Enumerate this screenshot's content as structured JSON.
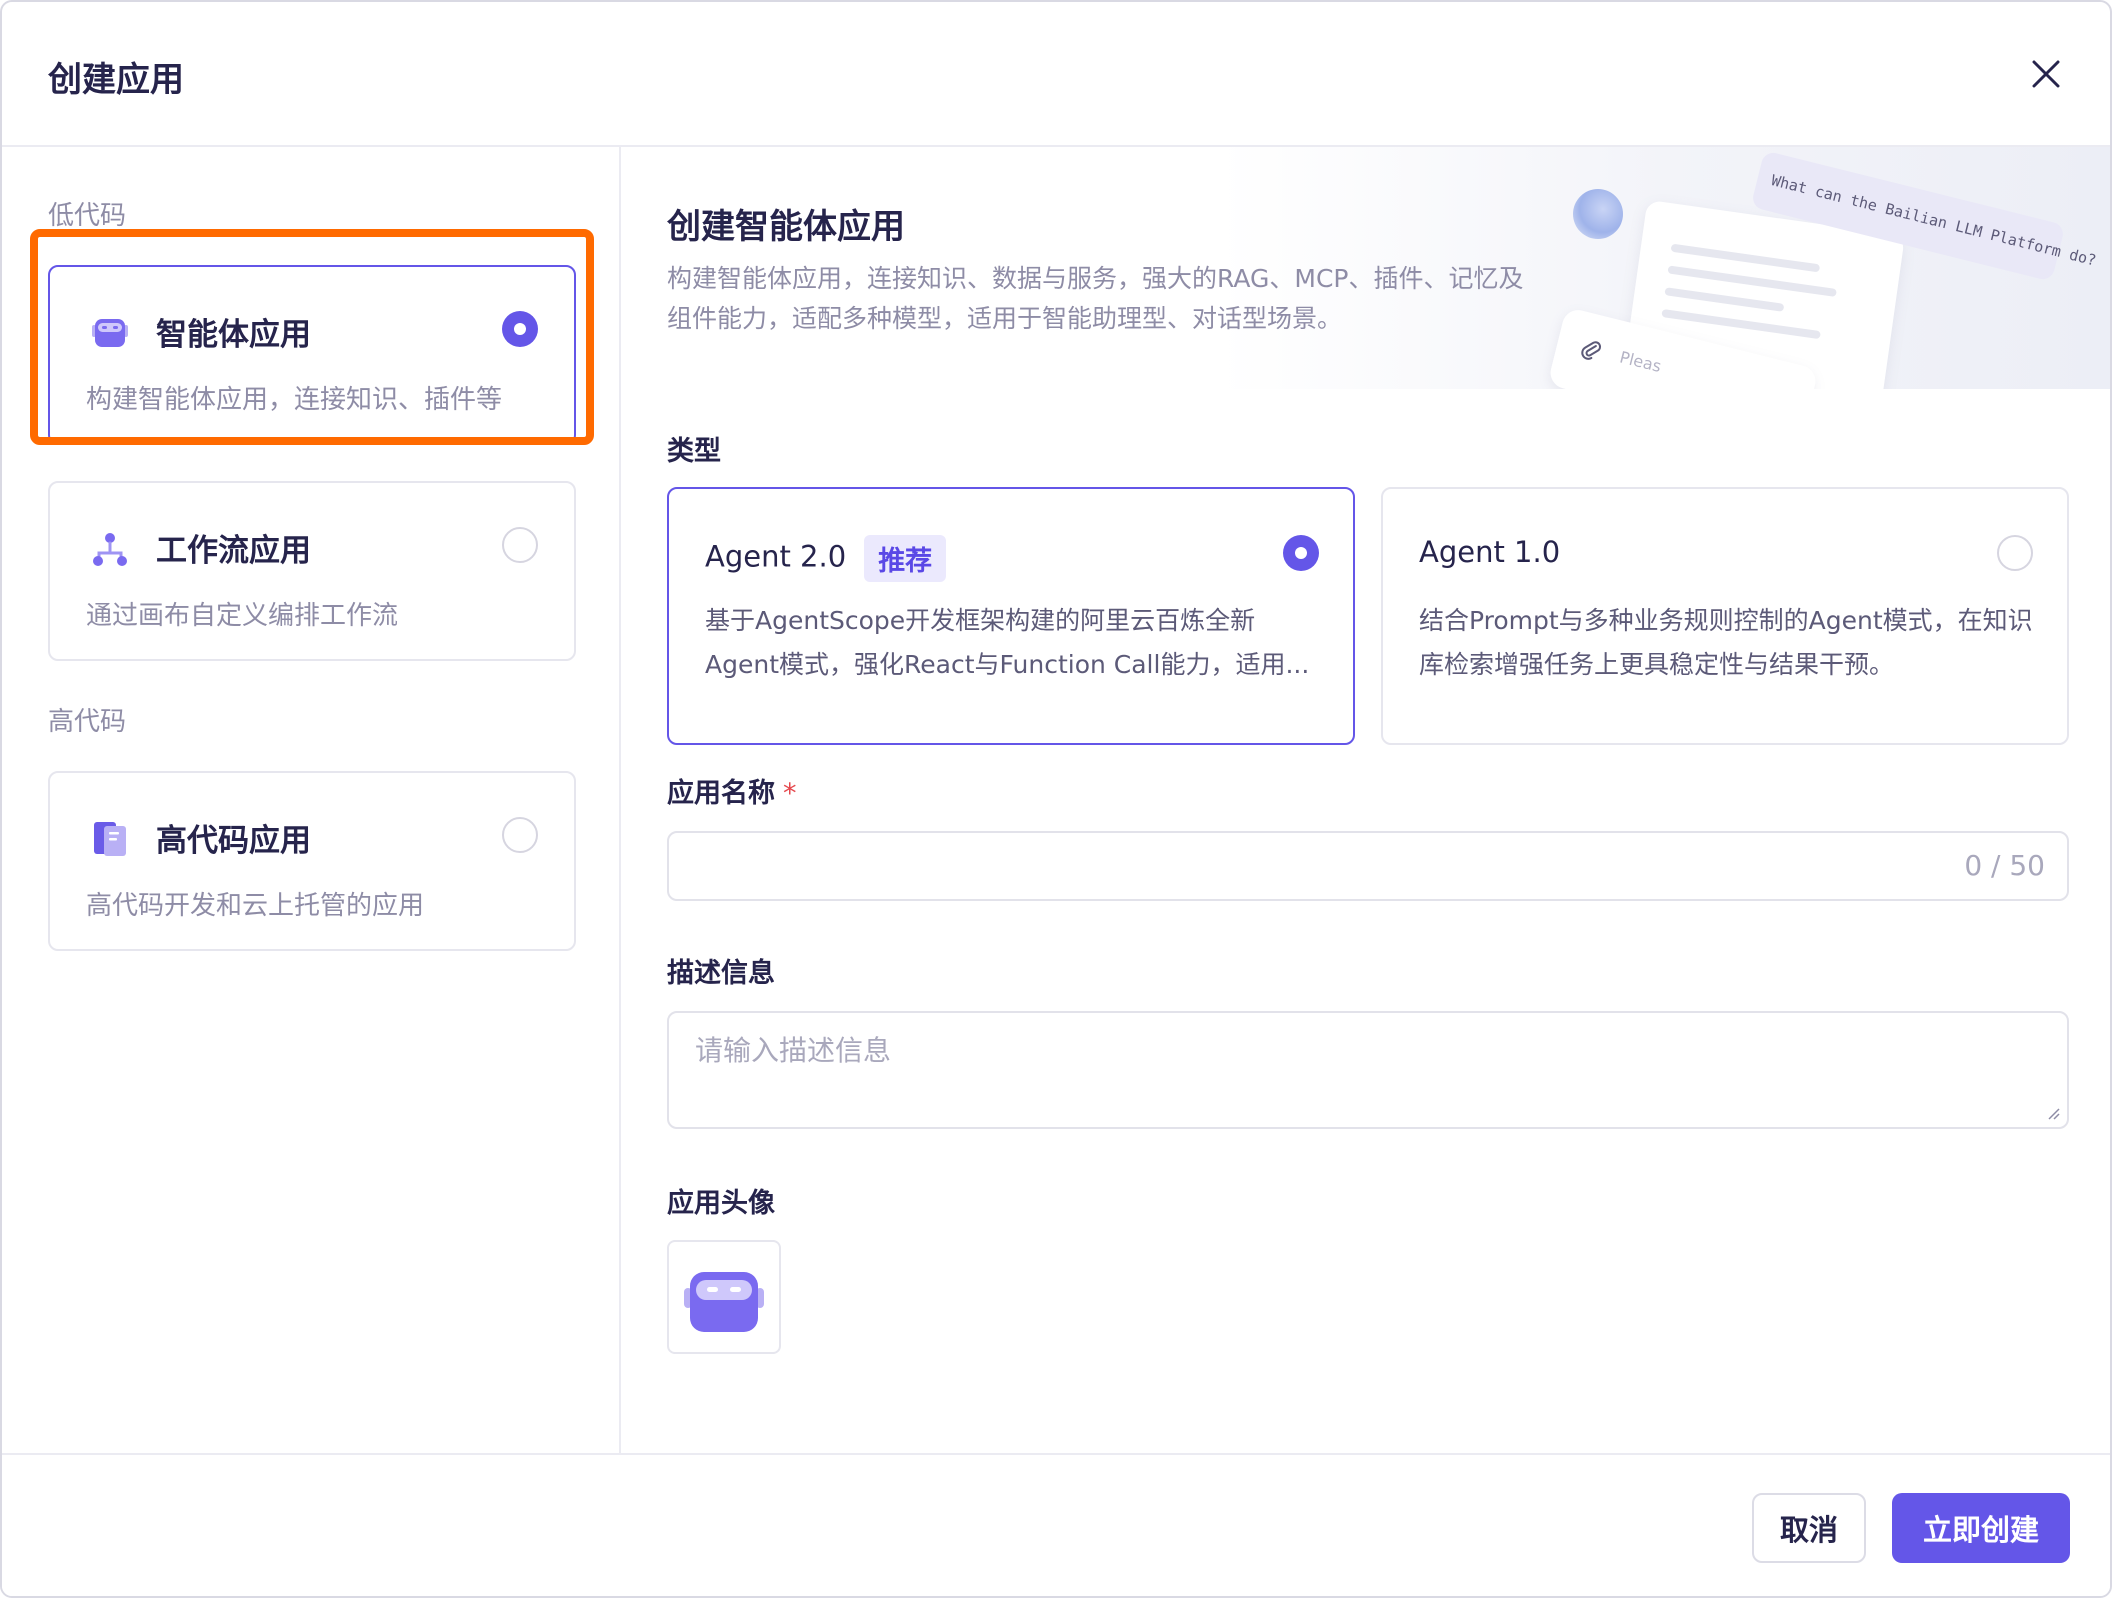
{
  "dialog": {
    "title": "创建应用",
    "close_icon": "close-icon"
  },
  "sidebar": {
    "low_code_label": "低代码",
    "high_code_label": "高代码",
    "items": [
      {
        "title": "智能体应用",
        "desc": "构建智能体应用，连接知识、插件等",
        "icon": "robot-icon",
        "selected": true
      },
      {
        "title": "工作流应用",
        "desc": "通过画布自定义编排工作流",
        "icon": "workflow-icon",
        "selected": false
      },
      {
        "title": "高代码应用",
        "desc": "高代码开发和云上托管的应用",
        "icon": "code-book-icon",
        "selected": false
      }
    ]
  },
  "banner": {
    "title": "创建智能体应用",
    "desc": "构建智能体应用，连接知识、数据与服务，强大的RAG、MCP、插件、记忆及组件能力，适配多种模型，适用于智能助理型、对话型场景。",
    "deco_prompt": "What can the Bailian LLM Platform do?",
    "deco_input": "Pleas"
  },
  "form": {
    "type_label": "类型",
    "agents": [
      {
        "title": "Agent 2.0",
        "tag": "推荐",
        "desc": "基于AgentScope开发框架构建的阿里云百炼全新Agent模式，强化React与Function Call能力，适用...",
        "selected": true
      },
      {
        "title": "Agent 1.0",
        "tag": "",
        "desc": "结合Prompt与多种业务规则控制的Agent模式，在知识库检索增强任务上更具稳定性与结果干预。",
        "selected": false
      }
    ],
    "name_label": "应用名称",
    "name_required": "*",
    "name_value": "",
    "name_counter": "0 / 50",
    "desc_label": "描述信息",
    "desc_placeholder": "请输入描述信息",
    "avatar_label": "应用头像",
    "avatar_icon": "robot-avatar-icon"
  },
  "footer": {
    "cancel_label": "取消",
    "create_label": "立即创建"
  },
  "colors": {
    "accent": "#6456e8",
    "highlight": "#ff6a00",
    "required": "#e5484d"
  }
}
